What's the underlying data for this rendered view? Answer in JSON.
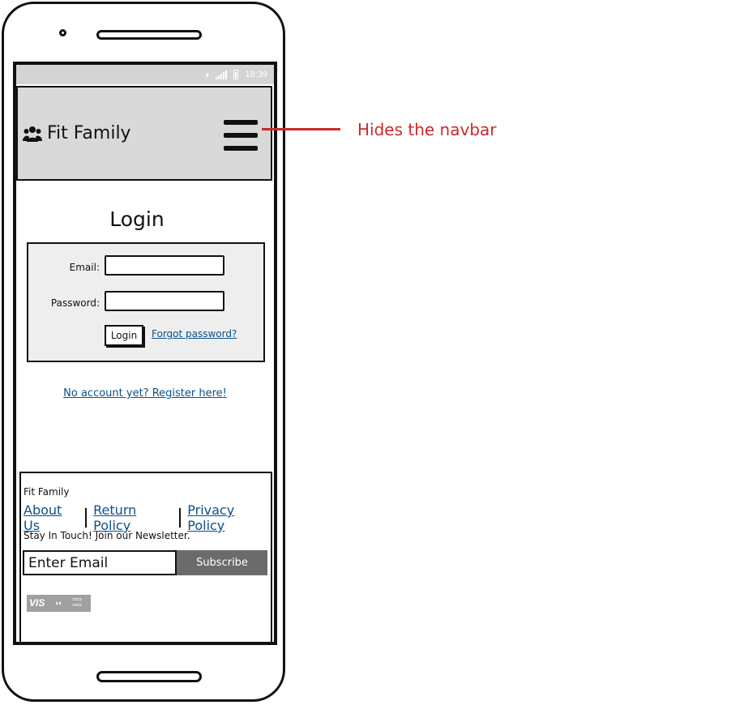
{
  "status_bar": {
    "time": "18:39",
    "icons": [
      "wifi-icon",
      "signal-icon",
      "battery-icon"
    ]
  },
  "header": {
    "brand_icon": "users-icon",
    "brand_name": "Fit Family",
    "menu_icon": "hamburger-menu-icon"
  },
  "annotation": {
    "text": "Hides the navbar",
    "color": "#cc2929"
  },
  "login": {
    "title": "Login",
    "email_label": "Email:",
    "email_value": "",
    "password_label": "Password:",
    "password_value": "",
    "button_label": "Login",
    "forgot_link": "Forgot password?"
  },
  "register_link": "No account yet? Register here!",
  "footer": {
    "brand": "Fit Family",
    "links": [
      "About Us",
      "Return Policy",
      "Privacy Policy"
    ],
    "newsletter_text": "Stay In Touch! Join our Newsletter.",
    "email_placeholder": "Enter Email",
    "subscribe_label": "Subscribe",
    "payment_icons": [
      "visa-icon",
      "mastercard-icon",
      "amex-icon"
    ]
  },
  "colors": {
    "link": "#0b4f8a",
    "header_bg": "#d9d9d9",
    "subscribe_bg": "#6b6b6b"
  }
}
